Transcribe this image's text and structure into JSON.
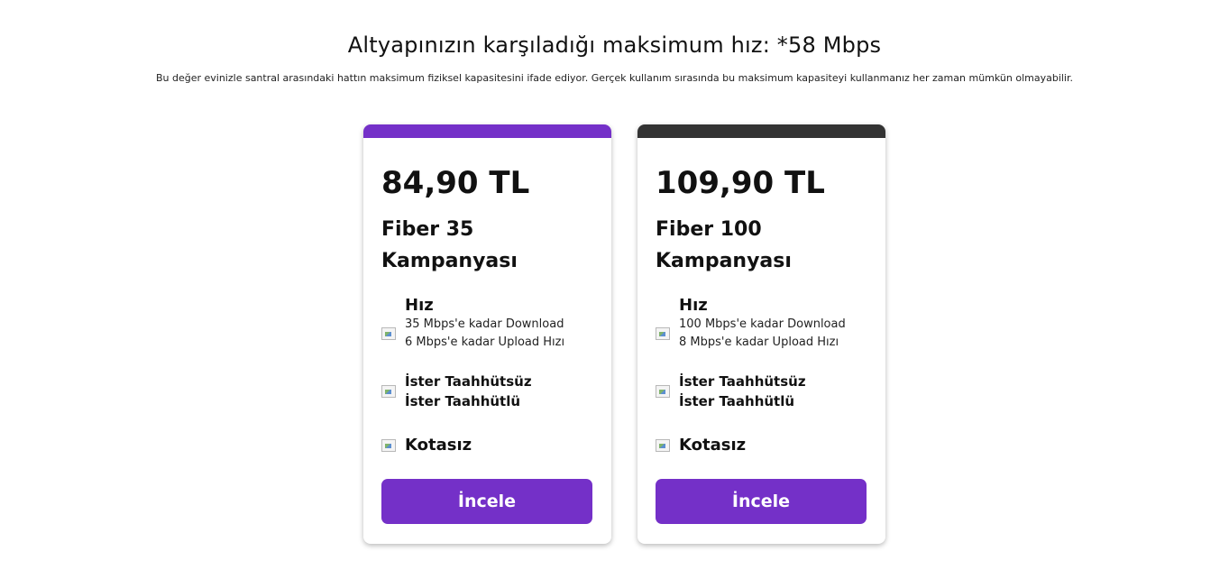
{
  "header": {
    "headline": "Altyapınızın karşıladığı maksimum hız: *58 Mbps",
    "subtext": "Bu değer evinizle santral arasındaki hattın maksimum fiziksel kapasitesini ifade ediyor. Gerçek kullanım sırasında bu maksimum kapasiteyi kullanmanız her zaman mümkün olmayabilir."
  },
  "colors": {
    "accent_purple": "#7430c8",
    "card1_bar": "#7430c8",
    "card2_bar": "#333333"
  },
  "plans": [
    {
      "price": "84,90 TL",
      "name": "Fiber 35 Kampanyası",
      "speed_title": "Hız",
      "download": "35 Mbps'e kadar Download",
      "upload": "6 Mbps'e kadar Upload Hızı",
      "commit_1": "İster Taahhütsüz",
      "commit_2": "İster Taahhütlü",
      "quota": "Kotasız",
      "button": "İncele"
    },
    {
      "price": "109,90 TL",
      "name": "Fiber 100 Kampanyası",
      "speed_title": "Hız",
      "download": "100 Mbps'e kadar Download",
      "upload": "8 Mbps'e kadar Upload Hızı",
      "commit_1": "İster Taahhütsüz",
      "commit_2": "İster Taahhütlü",
      "quota": "Kotasız",
      "button": "İncele"
    }
  ],
  "icons": {
    "speed": "speed-icon",
    "commitment": "commitment-icon",
    "quota": "quota-icon"
  }
}
